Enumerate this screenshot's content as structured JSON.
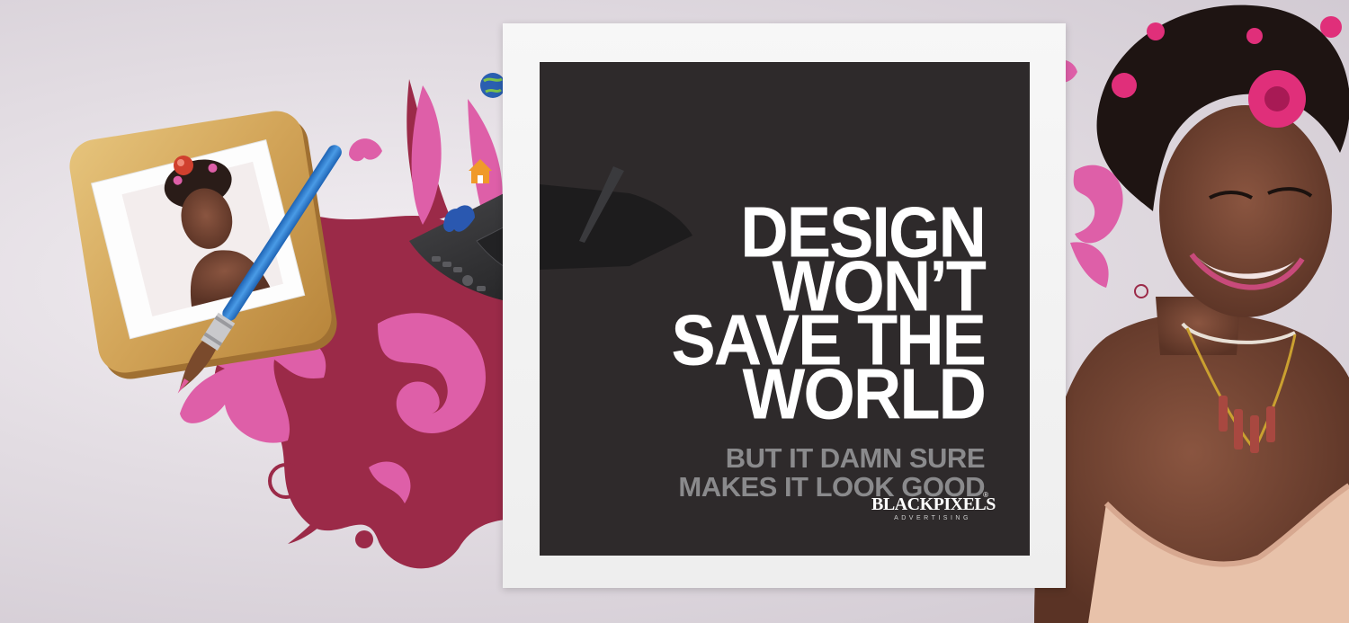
{
  "banner": {
    "headline_lines": [
      "DESIGN",
      "WON’T",
      "SAVE THE",
      "WORLD"
    ],
    "subline_lines": [
      "BUT IT DAMN SURE",
      "MAKES IT LOOK GOOD"
    ],
    "logo_name": "BLACKPIXELS",
    "logo_registered": "®",
    "logo_tagline": "ADVERTISING",
    "colors": {
      "panel": "#2e2a2b",
      "headline": "#ffffff",
      "subline": "#8a8a8c",
      "splash_crimson": "#9b2a48",
      "accent_pink": "#de5fa8"
    }
  },
  "decor": {
    "icons": [
      "photo-app-icon",
      "paintbrush-icon",
      "push-pin-icon",
      "drawing-tablet-icon",
      "globe-icon",
      "rss-icon",
      "heart-icon",
      "home-icon",
      "dollar-icon",
      "pencil-icon",
      "butterfly-icon",
      "woman-portrait"
    ]
  }
}
